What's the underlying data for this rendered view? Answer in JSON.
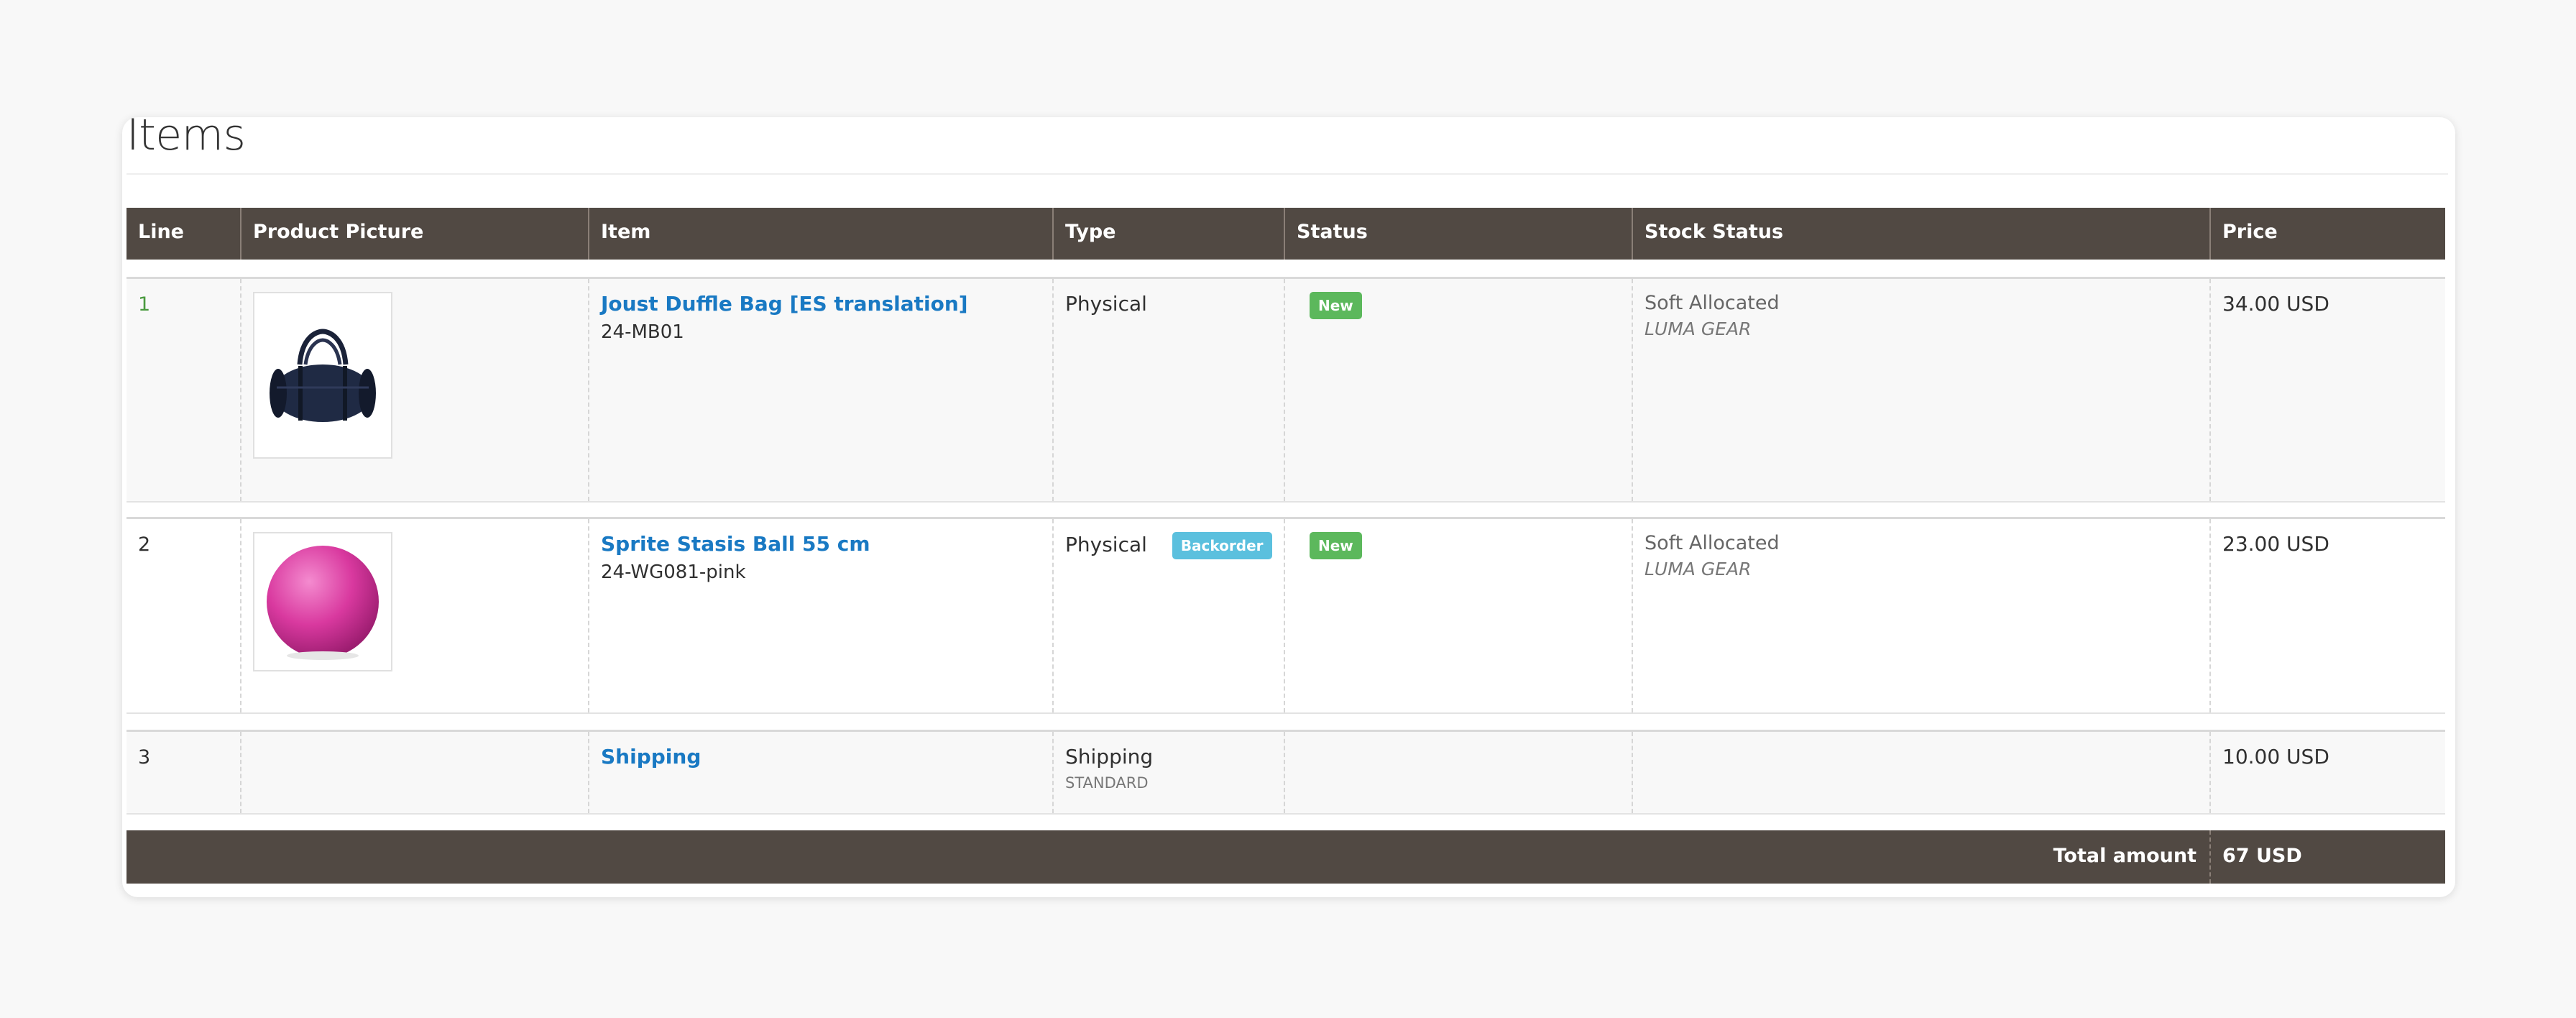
{
  "section": {
    "title": "Items"
  },
  "table": {
    "headers": [
      "Line",
      "Product Picture",
      "Item",
      "Type",
      "Status",
      "Stock Status",
      "Price"
    ],
    "rows": [
      {
        "line": "1",
        "picture": "duffle-bag",
        "item_name": "Joust Duffle Bag [ES translation]",
        "sku": "24-MB01",
        "type": "Physical",
        "type_badge": "",
        "type_sub": "",
        "status": "New",
        "stock_status": "Soft Allocated",
        "stock_source": "LUMA GEAR",
        "price": "34.00 USD"
      },
      {
        "line": "2",
        "picture": "stasis-ball",
        "item_name": "Sprite Stasis Ball 55 cm",
        "sku": "24-WG081-pink",
        "type": "Physical",
        "type_badge": "Backorder",
        "type_sub": "",
        "status": "New",
        "stock_status": "Soft Allocated",
        "stock_source": "LUMA GEAR",
        "price": "23.00 USD"
      },
      {
        "line": "3",
        "picture": "",
        "item_name": "Shipping",
        "sku": "",
        "type": "Shipping",
        "type_badge": "",
        "type_sub": "STANDARD",
        "status": "",
        "stock_status": "",
        "stock_source": "",
        "price": "10.00 USD"
      }
    ],
    "footer": {
      "label": "Total amount",
      "value": "67 USD"
    }
  },
  "colors": {
    "header_bg": "#514943",
    "link": "#1979c3",
    "badge_new": "#5cb85c",
    "badge_backorder": "#5bc0de",
    "bag": "#1f2a44",
    "ball": "#d9399f"
  }
}
